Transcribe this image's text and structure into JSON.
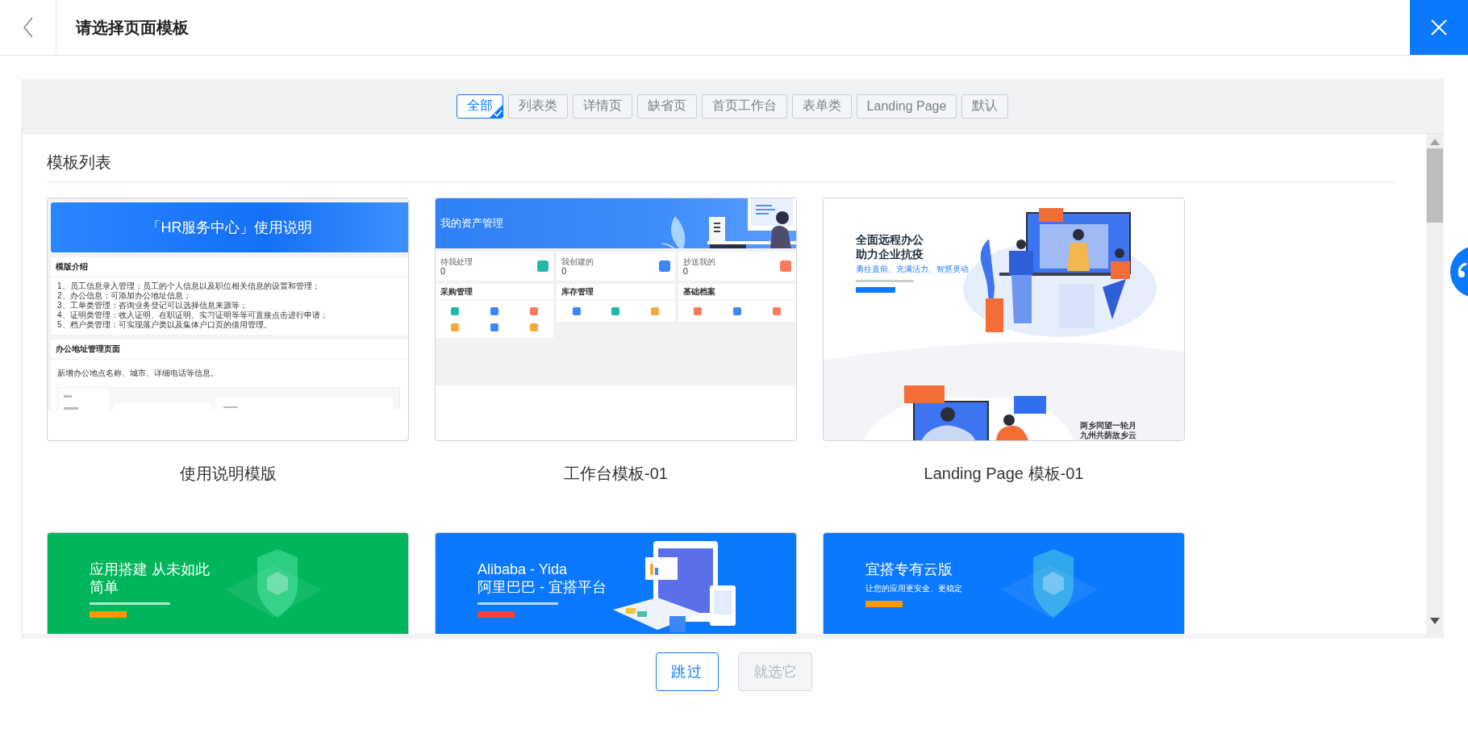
{
  "header": {
    "title": "请选择页面模板"
  },
  "filters": [
    {
      "label": "全部",
      "selected": true
    },
    {
      "label": "列表类",
      "selected": false
    },
    {
      "label": "详情页",
      "selected": false
    },
    {
      "label": "缺省页",
      "selected": false
    },
    {
      "label": "首页工作台",
      "selected": false
    },
    {
      "label": "表单类",
      "selected": false
    },
    {
      "label": "Landing Page",
      "selected": false
    },
    {
      "label": "默认",
      "selected": false
    }
  ],
  "section_title": "模板列表",
  "templates": [
    {
      "name": "使用说明模版",
      "kind": "guide",
      "preview": {
        "banner": "「HR服务中心」使用说明",
        "intro_title": "模版介绍",
        "intro_items": [
          "1、员工信息录入管理：员工的个人信息以及职位相关信息的设置和管理；",
          "2、办公信息：可添加办公地址信息；",
          "3、工单类管理：咨询业务登记可以选择信息来源等；",
          "4、证明类管理：收入证明、在职证明、实习证明等等可直接点击进行申请；",
          "5、档户类管理：可实现落户类以及集体户口页的借用管理。"
        ],
        "section_title": "办公地址管理页面",
        "section_text": "新增办公地点名称、城市、详细电话等信息。"
      }
    },
    {
      "name": "工作台模板-01",
      "kind": "workbench",
      "preview": {
        "banner": "我的资产管理",
        "stats": [
          {
            "label": "待我处理",
            "value": "0",
            "color": "#26b5a8"
          },
          {
            "label": "我创建的",
            "value": "0",
            "color": "#3d86f5"
          },
          {
            "label": "抄送我的",
            "value": "0",
            "color": "#f97a5c"
          }
        ],
        "groups": [
          {
            "title": "采购管理",
            "items": [
              {
                "color": "#26b5a8"
              },
              {
                "color": "#3d86f5"
              },
              {
                "color": "#f97a5c"
              },
              {
                "color": "#f5a93b"
              },
              {
                "color": "#3d86f5"
              },
              {
                "color": "#f5a93b"
              }
            ]
          },
          {
            "title": "库存管理",
            "items": [
              {
                "color": "#3d86f5"
              },
              {
                "color": "#26b5a8"
              },
              {
                "color": "#f5a93b"
              }
            ]
          },
          {
            "title": "基础档案",
            "items": [
              {
                "color": "#f97a5c"
              },
              {
                "color": "#3d86f5"
              },
              {
                "color": "#f97a5c"
              }
            ]
          }
        ]
      }
    },
    {
      "name": "Landing Page 模板-01",
      "kind": "landing",
      "preview": {
        "headline": [
          "全面远程办公",
          "助力企业抗疫"
        ],
        "tagline": "勇往直前、充满活力、智慧灵动",
        "poem": [
          "两乡同望一轮月",
          "九州共荫故乡云"
        ]
      }
    },
    {
      "kind": "hero",
      "preview": {
        "color": "#00b55b",
        "kind": "shield",
        "headline": [
          "应用搭建 从未如此",
          "简单"
        ],
        "button": {
          "color": "#ff9800"
        }
      }
    },
    {
      "kind": "hero",
      "preview": {
        "color": "#0a78ff",
        "kind": "devices",
        "headline": [
          "Alibaba - Yida",
          "阿里巴巴 - 宜搭平台"
        ],
        "button": {
          "color": "#f0443a"
        }
      }
    },
    {
      "kind": "hero",
      "preview": {
        "color": "#0a78ff",
        "kind": "shield",
        "headline": [
          "宜搭专有云版"
        ],
        "subtitle": "让您的应用更安全、更稳定",
        "button": {
          "color": "#ff9800"
        }
      }
    }
  ],
  "footer": {
    "buttons": [
      {
        "label": "跳过",
        "disabled": false
      },
      {
        "label": "就选它",
        "disabled": true
      }
    ]
  }
}
